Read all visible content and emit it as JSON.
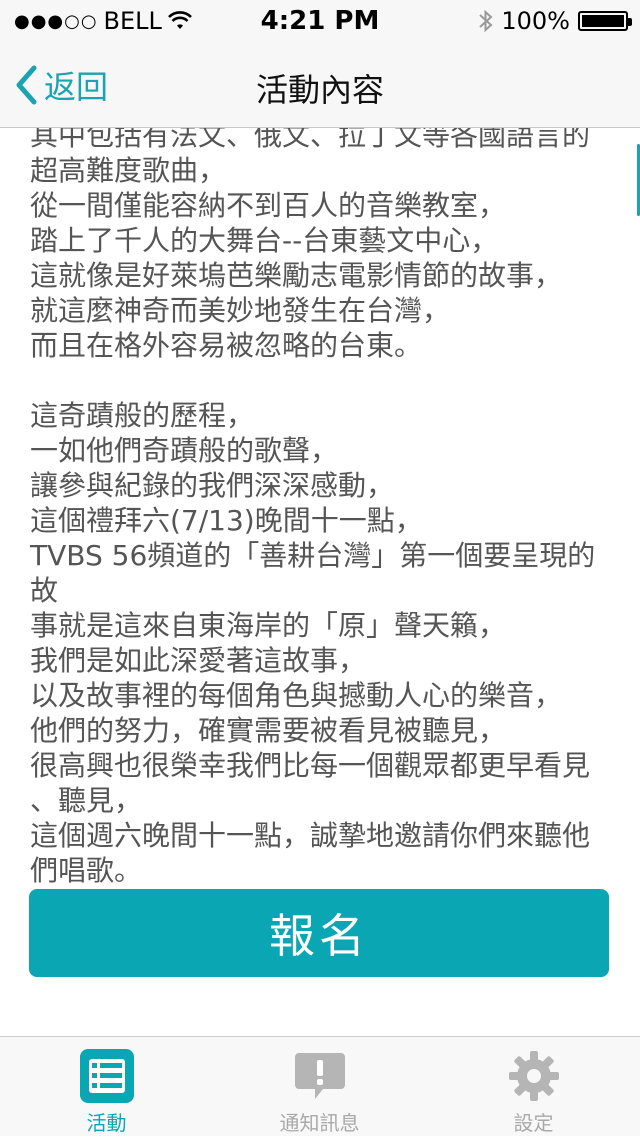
{
  "status_bar": {
    "carrier": "BELL",
    "time": "4:21 PM",
    "battery": "100%"
  },
  "nav": {
    "back_label": "返回",
    "title": "活動內容"
  },
  "article": {
    "text": "其中包括有法文、俄文、拉丁文等各國語言的\n超高難度歌曲，\n從一間僅能容納不到百人的音樂教室，\n踏上了千人的大舞台--台東藝文中心，\n這就像是好萊塢芭樂勵志電影情節的故事，\n就這麼神奇而美妙地發生在台灣，\n而且在格外容易被忽略的台東。\n\n這奇蹟般的歷程，\n一如他們奇蹟般的歌聲，\n讓參與紀錄的我們深深感動，\n這個禮拜六(7/13)晚間十一點，\nTVBS 56頻道的「善耕台灣」第一個要呈現的故\n事就是這來自東海岸的「原」聲天籟，\n我們是如此深愛著這故事，\n以及故事裡的每個角色與撼動人心的樂音，\n他們的努力，確實需要被看見被聽見，\n很高興也很榮幸我們比每一個觀眾都更早看見\n、聽見，\n這個週六晚間十一點，誠摯地邀請你們來聽他\n們唱歌。"
  },
  "signup_button": {
    "label": "報名"
  },
  "tabs": [
    {
      "label": "活動",
      "icon": "list-icon",
      "active": true
    },
    {
      "label": "通知訊息",
      "icon": "alert-message-icon",
      "active": false
    },
    {
      "label": "設定",
      "icon": "gear-icon",
      "active": false
    }
  ],
  "colors": {
    "accent": "#0ba6b4",
    "inactive": "#a9a9a9"
  }
}
